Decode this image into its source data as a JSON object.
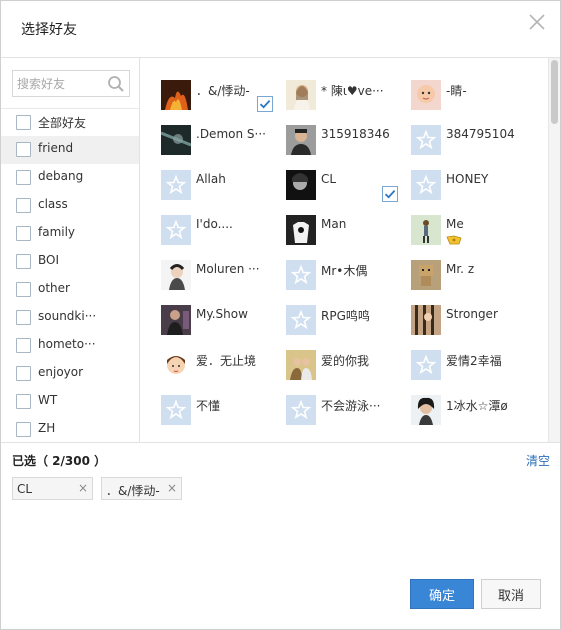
{
  "dialog": {
    "title": "选择好友"
  },
  "search": {
    "placeholder": "搜索好友"
  },
  "groups": [
    {
      "label": "全部好友",
      "active": false
    },
    {
      "label": "friend",
      "active": true
    },
    {
      "label": "debang",
      "active": false
    },
    {
      "label": "class",
      "active": false
    },
    {
      "label": "family",
      "active": false
    },
    {
      "label": "BOI",
      "active": false
    },
    {
      "label": "other",
      "active": false
    },
    {
      "label": "soundki···",
      "active": false
    },
    {
      "label": "hometo···",
      "active": false
    },
    {
      "label": "enjoyor",
      "active": false
    },
    {
      "label": "WT",
      "active": false
    },
    {
      "label": "ZH",
      "active": false
    }
  ],
  "friends": [
    {
      "name": "．&/悸动-",
      "avatar": "fire",
      "checked": true
    },
    {
      "name": "* 陳ι♥ve···",
      "avatar": "girl-photo",
      "checked": false
    },
    {
      "name": "-睛-",
      "avatar": "baby-photo",
      "checked": false
    },
    {
      "name": ".Demon S···",
      "avatar": "dark-photo",
      "checked": false
    },
    {
      "name": "315918346",
      "avatar": "man-photo",
      "checked": false
    },
    {
      "name": "384795104",
      "avatar": "default",
      "checked": false
    },
    {
      "name": "Allah",
      "avatar": "default",
      "checked": false
    },
    {
      "name": "CL",
      "avatar": "bw-photo",
      "checked": true
    },
    {
      "name": "HONEY",
      "avatar": "default",
      "checked": false
    },
    {
      "name": "I'do....",
      "avatar": "default",
      "checked": false
    },
    {
      "name": "Man",
      "avatar": "shirt-photo",
      "checked": false
    },
    {
      "name": "Me",
      "avatar": "walk-photo",
      "checked": false,
      "badge": true
    },
    {
      "name": "Moluren ···",
      "avatar": "cartoon-photo",
      "checked": false
    },
    {
      "name": "Mr•木偶",
      "avatar": "default",
      "checked": false
    },
    {
      "name": "Mr. z",
      "avatar": "box-photo",
      "checked": false
    },
    {
      "name": "My.Show",
      "avatar": "street-photo",
      "checked": false
    },
    {
      "name": "RPG鸣鸣",
      "avatar": "default",
      "checked": false
    },
    {
      "name": "Stronger",
      "avatar": "bars-photo",
      "checked": false
    },
    {
      "name": "爱．无止境",
      "avatar": "face-cartoon",
      "checked": false
    },
    {
      "name": "爱的你我",
      "avatar": "couple-photo",
      "checked": false
    },
    {
      "name": "爱情2幸福",
      "avatar": "default",
      "checked": false
    },
    {
      "name": "不懂",
      "avatar": "default",
      "checked": false
    },
    {
      "name": "不会游泳···",
      "avatar": "default",
      "checked": false
    },
    {
      "name": "1冰水☆潭ø",
      "avatar": "woman-photo",
      "checked": false
    }
  ],
  "selected": {
    "label": "已选（ 2/300 ）",
    "clear_label": "清空",
    "chips": [
      {
        "label": "CL"
      },
      {
        "label": "．&/悸动-"
      }
    ],
    "remove_glyph": "×"
  },
  "buttons": {
    "ok_label": "确定",
    "cancel_label": "取消"
  },
  "colors": {
    "accent": "#3a86d6",
    "link": "#2b6fb6",
    "default_avatar": "#cfdff0"
  }
}
